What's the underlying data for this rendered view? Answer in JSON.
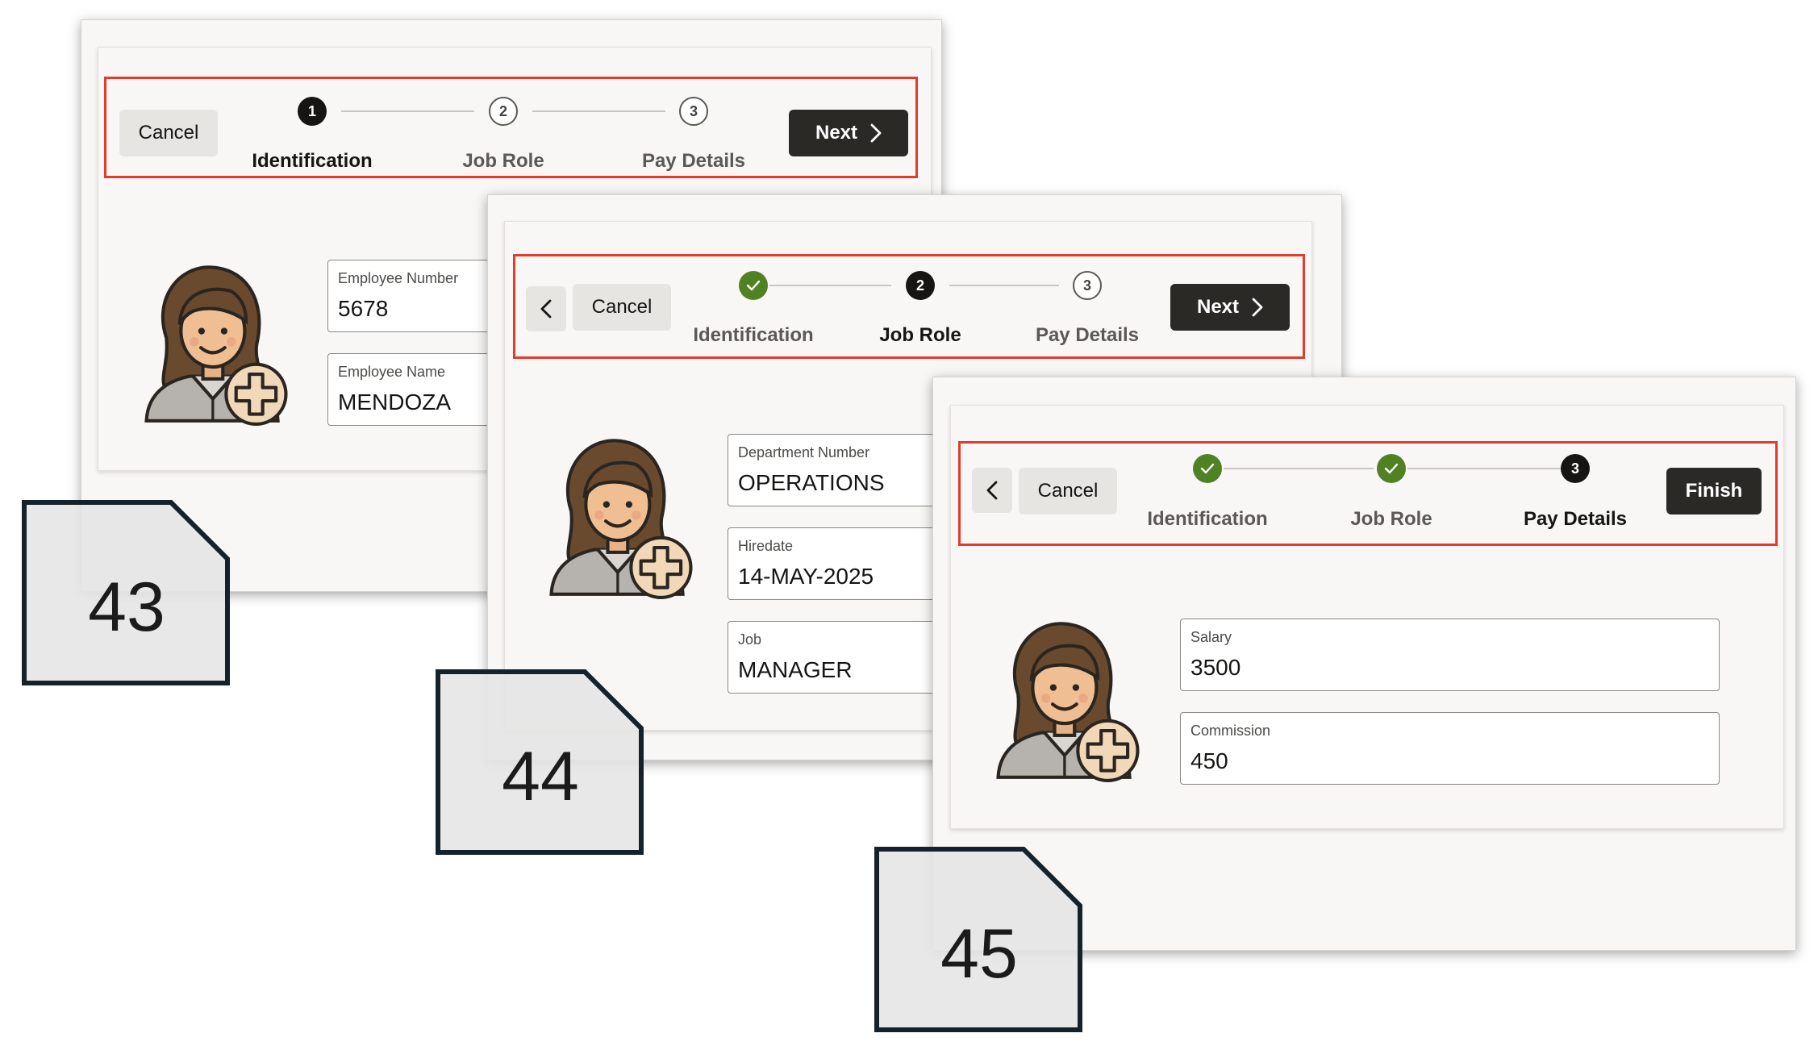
{
  "steps": {
    "identification": "Identification",
    "job_role": "Job Role",
    "pay_details": "Pay Details",
    "num1": "1",
    "num2": "2",
    "num3": "3"
  },
  "buttons": {
    "cancel": "Cancel",
    "next": "Next",
    "finish": "Finish"
  },
  "screen43": {
    "badge": "43",
    "fields": [
      {
        "label": "Employee Number",
        "value": "5678"
      },
      {
        "label": "Employee Name",
        "value": "MENDOZA"
      }
    ]
  },
  "screen44": {
    "badge": "44",
    "fields": [
      {
        "label": "Department Number",
        "value": "OPERATIONS"
      },
      {
        "label": "Hiredate",
        "value": "14-MAY-2025"
      },
      {
        "label": "Job",
        "value": "MANAGER"
      }
    ]
  },
  "screen45": {
    "badge": "45",
    "fields": [
      {
        "label": "Salary",
        "value": "3500"
      },
      {
        "label": "Commission",
        "value": "450"
      }
    ]
  },
  "colors": {
    "highlight": "#e33b2e",
    "done_step": "#508223",
    "primary_button": "#2b2926"
  },
  "icons": [
    "check-icon",
    "chevron-right-icon",
    "chevron-left-icon",
    "add-person-avatar-icon",
    "document-page-icon"
  ]
}
